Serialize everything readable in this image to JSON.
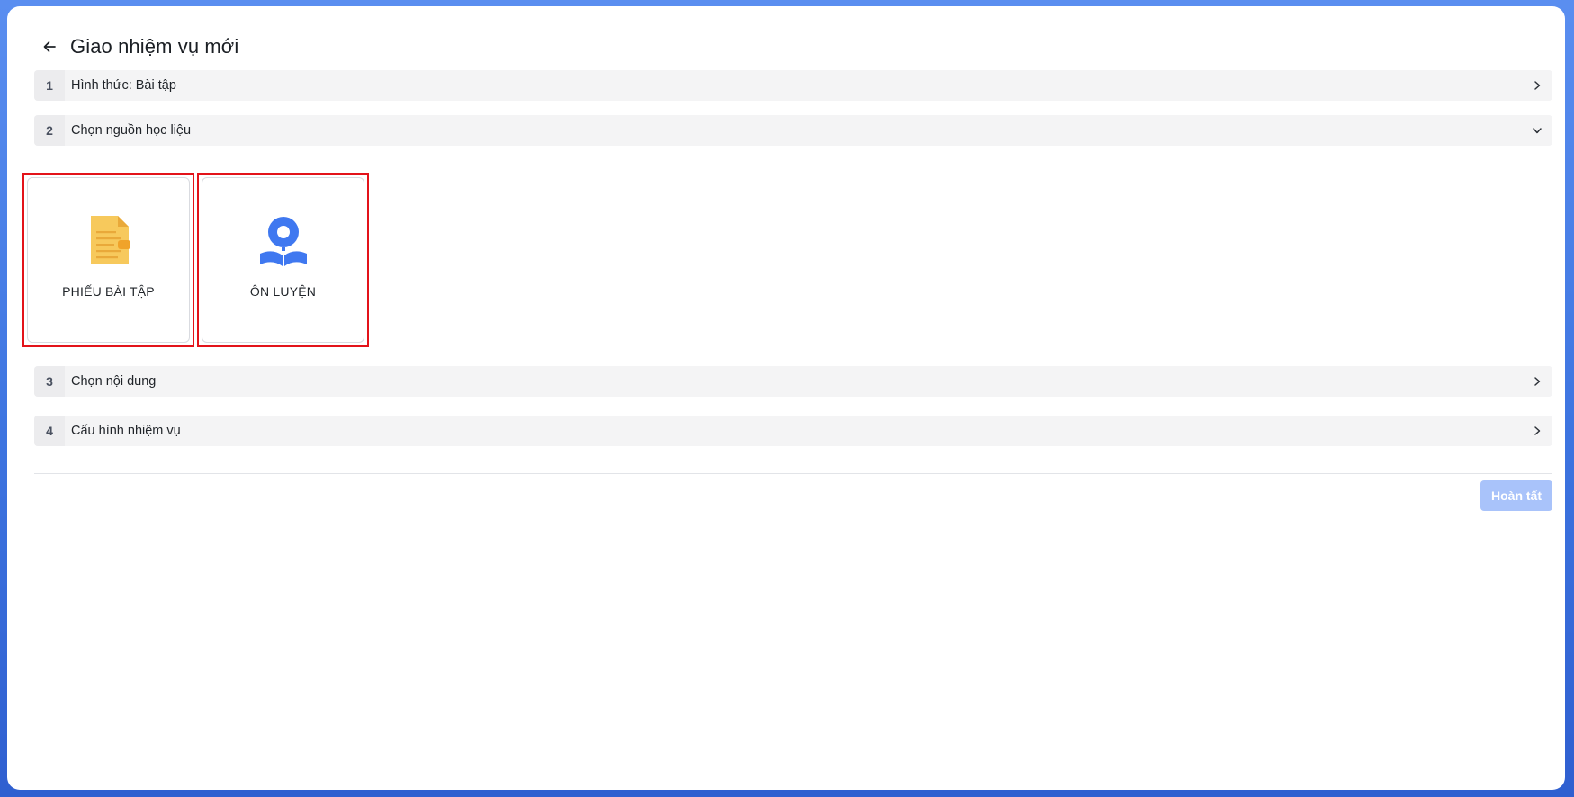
{
  "header": {
    "title": "Giao nhiệm vụ mới",
    "back_icon": "arrow-left-icon"
  },
  "steps": [
    {
      "number": "1",
      "label": "Hình thức: Bài tập",
      "state": "collapsed",
      "chevron_icon": "chevron-right-icon"
    },
    {
      "number": "2",
      "label": "Chọn nguồn học liệu",
      "state": "expanded",
      "chevron_icon": "chevron-down-icon"
    },
    {
      "number": "3",
      "label": "Chọn nội dung",
      "state": "collapsed",
      "chevron_icon": "chevron-right-icon"
    },
    {
      "number": "4",
      "label": "Cấu hình nhiệm vụ",
      "state": "collapsed",
      "chevron_icon": "chevron-right-icon"
    }
  ],
  "sources": [
    {
      "label": "PHIẾU BÀI TẬP",
      "icon": "worksheet-icon"
    },
    {
      "label": "ÔN LUYỆN",
      "icon": "practice-reader-icon"
    }
  ],
  "footer": {
    "finish_label": "Hoàn tất",
    "finish_state": "disabled"
  },
  "colors": {
    "background_gradient_top": "#5a8ef0",
    "background_gradient_bottom": "#2f5fd0",
    "step_bg": "#f4f4f5",
    "highlight_border": "#e3131a",
    "primary_disabled": "#a9c3fa",
    "worksheet_yellow": "#f7c95c",
    "practice_blue": "#3f78f0"
  }
}
